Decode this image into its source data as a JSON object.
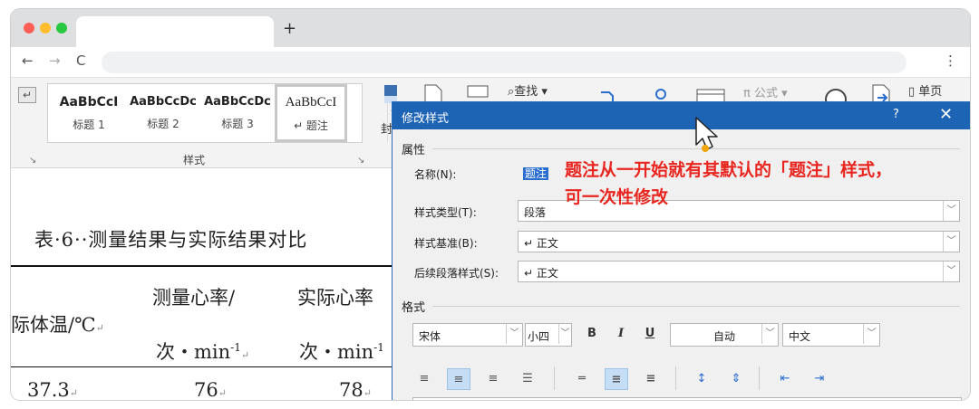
{
  "browser": {
    "new_tab": "+",
    "back": "←",
    "forward": "→",
    "reload": "C",
    "menu": "⋮"
  },
  "ribbon": {
    "styles": [
      {
        "preview": "AaBbCcI",
        "label": "标题 1"
      },
      {
        "preview": "AaBbCcDc",
        "label": "标题 2"
      },
      {
        "preview": "AaBbCcDc",
        "label": "标题 3"
      },
      {
        "preview": "AaBbCcI",
        "label": "↵ 题注"
      }
    ],
    "group_label": "样式",
    "tools": {
      "find": "查找 ▾",
      "formula": "π 公式 ▾",
      "single_page": "单页",
      "cover": "封"
    }
  },
  "document": {
    "caption": "表·6··测量结果与实际结果对比",
    "col1_header": "际体温/℃",
    "col2_header_line1": "测量心率/",
    "col2_header_line2": "次・min",
    "col3_header_line1": "实际心率",
    "col3_header_line2": "次・min",
    "superscript": "-1",
    "row1": [
      "37.3",
      "76",
      "78"
    ],
    "para_mark": "↵"
  },
  "dialog": {
    "title": "修改样式",
    "help": "?",
    "close": "✕",
    "section_properties": "属性",
    "name_label": "名称(N):",
    "name_value": "题注",
    "type_label": "样式类型(T):",
    "type_value": "段落",
    "based_label": "样式基准(B):",
    "based_value": "↵ 正文",
    "next_label": "后续段落样式(S):",
    "next_value": "↵ 正文",
    "section_format": "格式",
    "font": "宋体",
    "size": "小四",
    "bold": "B",
    "italic": "I",
    "underline": "U",
    "color": "自动",
    "script": "中文"
  },
  "annotation": {
    "line1": "题注从一开始就有其默认的「题注」样式，",
    "line2": "可一次性修改"
  }
}
